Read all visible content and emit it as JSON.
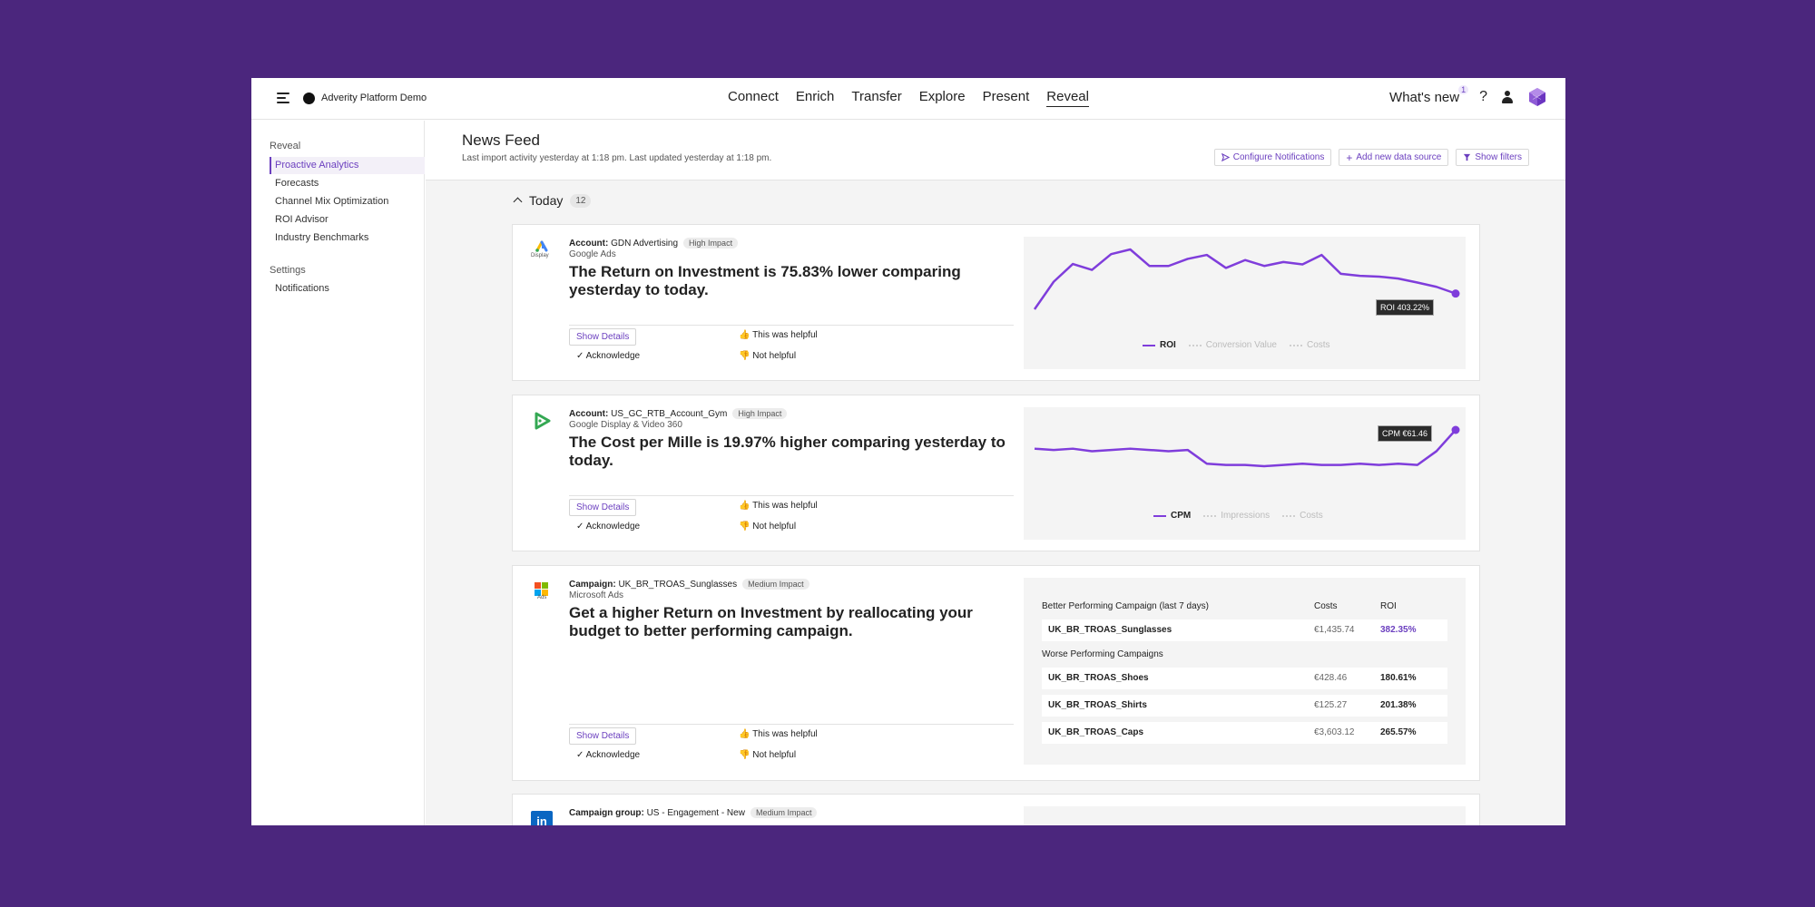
{
  "app": {
    "workspace": "Adverity Platform Demo",
    "nav": [
      "Connect",
      "Enrich",
      "Transfer",
      "Explore",
      "Present",
      "Reveal"
    ],
    "active_nav": "Reveal",
    "whats_new_label": "What's new",
    "whats_new_count": "1",
    "help_label": "?"
  },
  "sidebar": {
    "section1": "Reveal",
    "items": [
      "Proactive Analytics",
      "Forecasts",
      "Channel Mix Optimization",
      "ROI Advisor",
      "Industry Benchmarks"
    ],
    "section2": "Settings",
    "settings_items": [
      "Notifications"
    ]
  },
  "header": {
    "title": "News Feed",
    "subtitle": "Last import activity yesterday at 1:18 pm. Last updated yesterday at 1:18 pm.",
    "buttons": [
      "Configure Notifications",
      "Add new data source",
      "Show filters"
    ]
  },
  "feed": {
    "group_label": "Today",
    "group_count": "12"
  },
  "actions": {
    "show_details": "Show Details",
    "acknowledge": "Acknowledge",
    "helpful": "This was helpful",
    "not_helpful": "Not helpful"
  },
  "cards": [
    {
      "meta_label": "Account:",
      "meta_value": "GDN Advertising",
      "impact": "High Impact",
      "source": "Google Ads",
      "logo_caption": "Display",
      "title": "The Return on Investment is 75.83% lower comparing yesterday to today.",
      "tooltip": "ROI 403.22%",
      "legend": [
        "ROI",
        "Conversion Value",
        "Costs"
      ]
    },
    {
      "meta_label": "Account:",
      "meta_value": "US_GC_RTB_Account_Gym",
      "impact": "High Impact",
      "source": "Google Display & Video 360",
      "title": "The Cost per Mille is 19.97% higher comparing yesterday to today.",
      "tooltip": "CPM €61.46",
      "legend": [
        "CPM",
        "Impressions",
        "Costs"
      ]
    },
    {
      "meta_label": "Campaign:",
      "meta_value": "UK_BR_TROAS_Sunglasses",
      "impact": "Medium Impact",
      "source": "Microsoft Ads",
      "logo_caption": "Ads",
      "title": "Get a higher Return on Investment by reallocating your budget to better performing campaign.",
      "table": {
        "better_header": "Better Performing Campaign (last 7 days)",
        "col_costs": "Costs",
        "col_roi": "ROI",
        "better": {
          "name": "UK_BR_TROAS_Sunglasses",
          "costs": "€1,435.74",
          "roi": "382.35%"
        },
        "worse_header": "Worse Performing Campaigns",
        "worse": [
          {
            "name": "UK_BR_TROAS_Shoes",
            "costs": "€428.46",
            "roi": "180.61%"
          },
          {
            "name": "UK_BR_TROAS_Shirts",
            "costs": "€125.27",
            "roi": "201.38%"
          },
          {
            "name": "UK_BR_TROAS_Caps",
            "costs": "€3,603.12",
            "roi": "265.57%"
          }
        ]
      }
    },
    {
      "meta_label": "Campaign group:",
      "meta_value": "US - Engagement - New",
      "impact": "Medium Impact",
      "logo_caption": "in"
    }
  ],
  "colors": {
    "background": "#4b267d",
    "accent": "#7f3ddb",
    "accent_text": "#6b3fbf"
  },
  "chart_data": [
    {
      "type": "line",
      "series": [
        {
          "name": "ROI",
          "values": [
            50,
            120,
            165,
            150,
            190,
            202,
            160,
            160,
            178,
            188,
            155,
            175,
            160,
            170,
            164,
            188,
            140,
            135,
            133,
            128,
            118,
            107,
            90
          ]
        }
      ],
      "legend": [
        "ROI",
        "Conversion Value",
        "Costs"
      ],
      "annotation": "ROI 403.22%"
    },
    {
      "type": "line",
      "series": [
        {
          "name": "CPM",
          "values": [
            40,
            39,
            40,
            38,
            39,
            40,
            39,
            38,
            39,
            28,
            27,
            27,
            26,
            27,
            28,
            27,
            27,
            28,
            27,
            28,
            27,
            38,
            55
          ]
        }
      ],
      "legend": [
        "CPM",
        "Impressions",
        "Costs"
      ],
      "annotation": "CPM €61.46"
    }
  ]
}
